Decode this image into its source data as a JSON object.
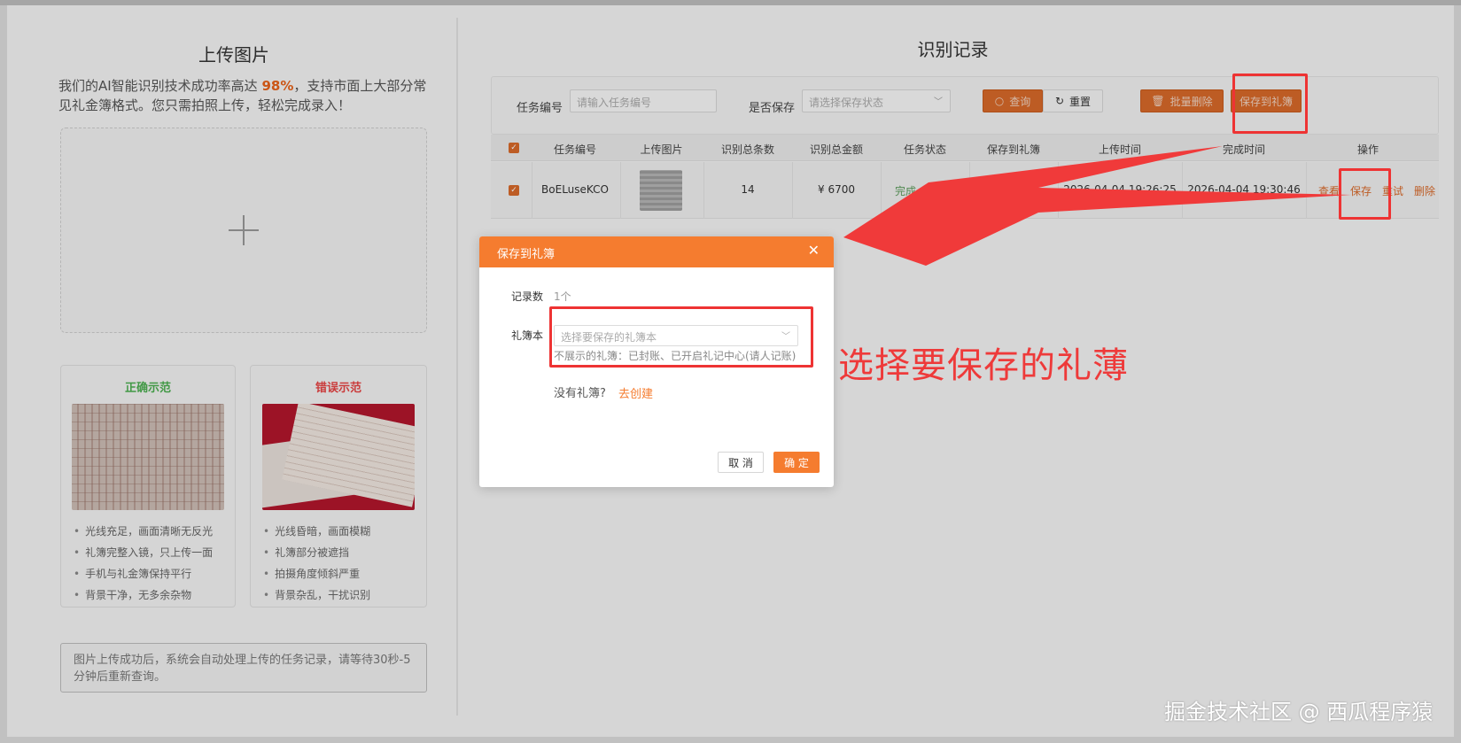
{
  "left": {
    "title": "上传图片",
    "desc_before": "我们的AI智能识别技术成功率高达 ",
    "desc_highlight": "98%",
    "desc_after": "，支持市面上大部分常见礼金簿格式。您只需拍照上传，轻松完成录入！",
    "correct_title": "正确示范",
    "correct_items": [
      "光线充足，画面清晰无反光",
      "礼簿完整入镜，只上传一面",
      "手机与礼金簿保持平行",
      "背景干净，无多余杂物"
    ],
    "wrong_title": "错误示范",
    "wrong_items": [
      "光线昏暗，画面模糊",
      "礼簿部分被遮挡",
      "拍摄角度倾斜严重",
      "背景杂乱，干扰识别"
    ],
    "notice": "图片上传成功后，系统会自动处理上传的任务记录，请等待30秒-5分钟后重新查询。"
  },
  "right": {
    "title": "识别记录",
    "filter": {
      "task_no_label": "任务编号",
      "task_no_placeholder": "请输入任务编号",
      "saved_label": "是否保存",
      "saved_placeholder": "请选择保存状态",
      "query": "查询",
      "reset": "重置",
      "batch_delete": "批量删除",
      "save_to_book": "保存到礼簿"
    },
    "columns": [
      "任务编号",
      "上传图片",
      "识别总条数",
      "识别总金额",
      "任务状态",
      "保存到礼簿",
      "上传时间",
      "完成时间",
      "操作"
    ],
    "row": {
      "task_no": "BoELuseKCO",
      "count": "14",
      "amount": "¥ 6700",
      "status": "完成",
      "saved": "",
      "upload_time": "2026-04-04 19:26:25",
      "finish_time": "2026-04-04 19:30:46",
      "ops": [
        "查看",
        "保存",
        "重试",
        "删除"
      ]
    }
  },
  "dialog": {
    "title": "保存到礼簿",
    "count_label": "记录数",
    "count_value": "1个",
    "book_label": "礼簿本",
    "book_placeholder": "选择要保存的礼簿本",
    "hint": "不展示的礼簿：已封账、已开启礼记中心(请人记账)",
    "no_book": "没有礼簿?",
    "create": "去创建",
    "cancel": "取 消",
    "ok": "确 定"
  },
  "annotation": {
    "text": "选择要保存的礼薄",
    "color": "#ee3333"
  },
  "watermark": "掘金技术社区 @ 西瓜程序猿",
  "colors": {
    "accent": "#f57c2f",
    "accent_dim": "#d8692a",
    "success": "#4caf50",
    "danger": "#e64545"
  }
}
